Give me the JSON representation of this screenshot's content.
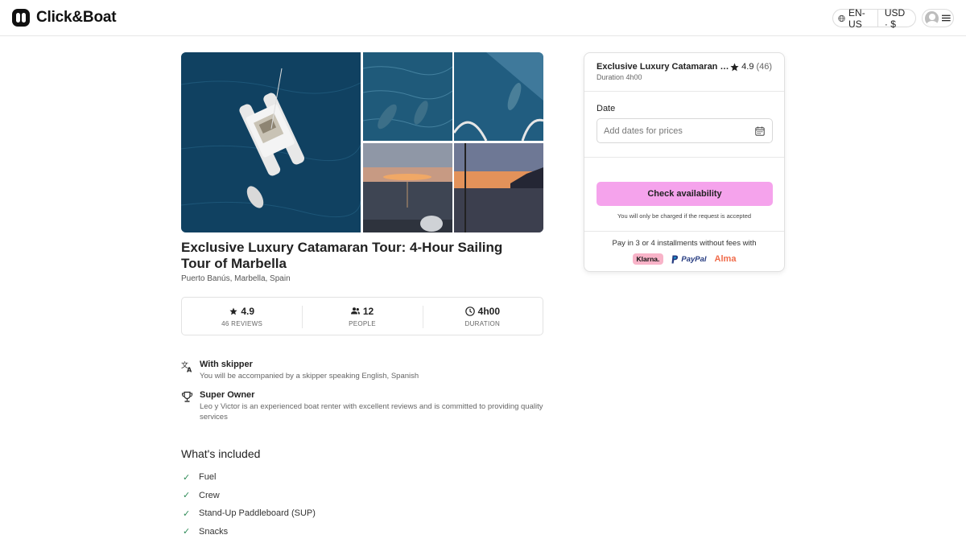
{
  "header": {
    "logo_text": "Click&Boat",
    "language": "EN-US",
    "currency": "USD · $"
  },
  "listing": {
    "title": "Exclusive Luxury Catamaran Tour: 4-Hour Sailing Tour of Marbella",
    "location": "Puerto Banús, Marbella, Spain"
  },
  "stats": [
    {
      "value": "4.9",
      "label": "46 REVIEWS",
      "icon": "star-icon"
    },
    {
      "value": "12",
      "label": "PEOPLE",
      "icon": "people-icon"
    },
    {
      "value": "4h00",
      "label": "DURATION",
      "icon": "clock-icon"
    }
  ],
  "features": [
    {
      "title": "With skipper",
      "description": "You will be accompanied by a skipper speaking English, Spanish",
      "icon": "translate-icon"
    },
    {
      "title": "Super Owner",
      "description": "Leo y Victor is an experienced boat renter with excellent reviews and is committed to providing quality services",
      "icon": "trophy-icon"
    }
  ],
  "included": {
    "title": "What's included",
    "items": [
      "Fuel",
      "Crew",
      "Stand-Up Paddleboard (SUP)",
      "Snacks"
    ]
  },
  "booking": {
    "title": "Exclusive Luxury Catamaran To...",
    "duration": "Duration 4h00",
    "rating": "4.9",
    "reviews": "(46)",
    "date_label": "Date",
    "date_placeholder": "Add dates for prices",
    "cta": "Check availability",
    "cta_note": "You will only be charged if the request is accepted",
    "installments": "Pay in 3 or 4 installments without fees with",
    "payment_providers": [
      "Klarna.",
      "PayPal",
      "Alma"
    ]
  },
  "colors": {
    "cta": "#f5a3ec",
    "check": "#2e8b57",
    "alma": "#f06b4a",
    "paypal_dark": "#253b80",
    "paypal_light": "#179bd7"
  }
}
